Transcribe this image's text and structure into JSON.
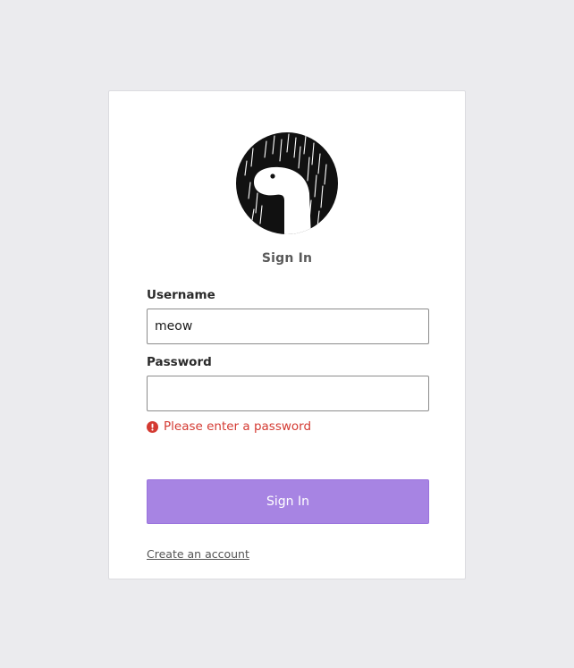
{
  "login": {
    "logo_icon": "dino-in-rain-logo",
    "title": "Sign In",
    "username_label": "Username",
    "username_value": "meow",
    "password_label": "Password",
    "password_value": "",
    "error_icon": "exclamation-circle-icon",
    "error_message": "Please enter a password",
    "submit_label": "Sign In",
    "create_account_link": "Create an account"
  },
  "colors": {
    "background": "#ebebee",
    "card": "#ffffff",
    "accent": "#a784e3",
    "error": "#d43a32"
  }
}
